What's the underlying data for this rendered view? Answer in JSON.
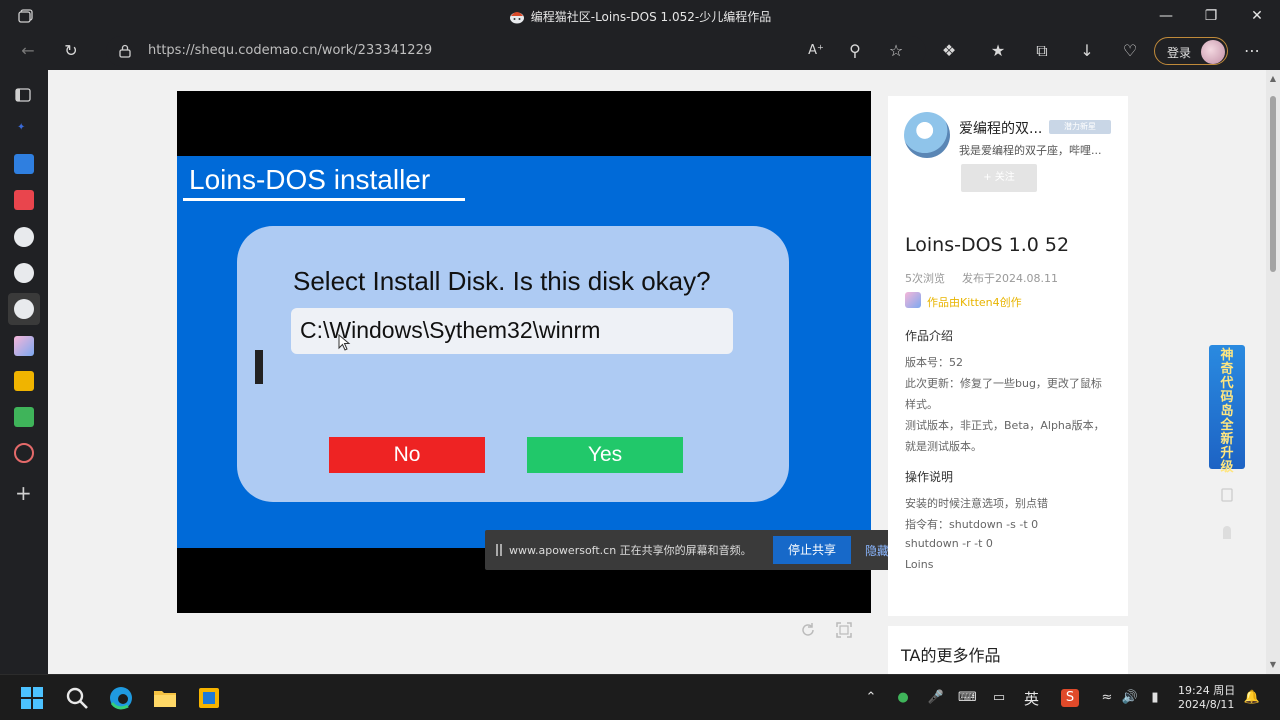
{
  "browser": {
    "window_title": "编程猫社区-Loins-DOS 1.052-少儿编程作品",
    "url": "https://shequ.codemao.cn/work/233341229",
    "login_label": "登录",
    "window_controls": [
      "minimize-icon",
      "restore-icon",
      "close-icon"
    ]
  },
  "game": {
    "installer_title": "Loins-DOS installer",
    "question": "Select Install Disk. Is this disk okay?",
    "disk_path": "C:\\Windows\\Sythem32\\winrm",
    "no_label": "No",
    "yes_label": "Yes",
    "colors": {
      "blue_bg": "#006ad8",
      "dialog": "#aecbf3",
      "no": "#ee2323",
      "yes": "#21c86a"
    }
  },
  "share_bar": {
    "message": "www.apowersoft.cn 正在共享你的屏幕和音频。",
    "stop_label": "停止共享",
    "hide_label": "隐藏"
  },
  "author": {
    "name": "爱编程的双...",
    "badge": "潜力新星",
    "bio": "我是爱编程的双子座，哔哩...",
    "follow_label": "+ 关注"
  },
  "work": {
    "title": "Loins-DOS 1.0 52",
    "views": "5次浏览",
    "published": "发布于2024.08.11",
    "creator": "作品由Kitten4创作",
    "intro_heading": "作品介绍",
    "intro_lines": [
      "版本号：52",
      "此次更新：修复了一些bug，更改了鼠标",
      "样式。",
      "测试版本，非正式，Beta，Alpha版本，",
      "就是测试版本。"
    ],
    "ops_heading": "操作说明",
    "ops_lines": [
      "安装的时候注意选项，别点错",
      "指令有：shutdown -s -t 0",
      "shutdown -r -t 0",
      "Loins"
    ],
    "more_works": "TA的更多作品"
  },
  "ad": {
    "text": "神奇代码岛全新升级"
  },
  "taskbar": {
    "time": "19:24 周日",
    "date": "2024/8/11",
    "ime": "英"
  }
}
